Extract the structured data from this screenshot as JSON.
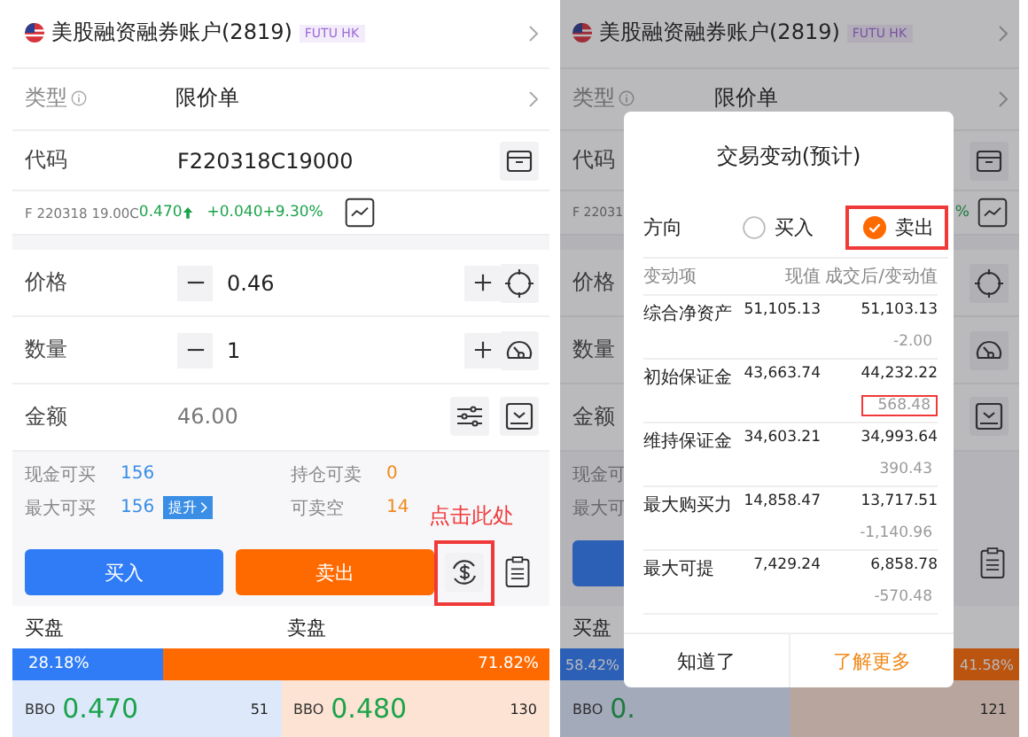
{
  "order_screen": {
    "account": {
      "name": "美股融资融券账户(2819)",
      "badge": "FUTU HK"
    },
    "order_type": {
      "label": "类型",
      "value": "限价单"
    },
    "code": {
      "label": "代码",
      "value": "F220318C19000"
    },
    "quote": {
      "name": "F 220318 19.00C",
      "price": "0.470",
      "change": "+0.040",
      "change_pct": "+9.30%"
    },
    "price": {
      "label": "价格",
      "value": "0.46"
    },
    "quantity": {
      "label": "数量",
      "value": "1"
    },
    "amount": {
      "label": "金额",
      "value": "46.00"
    },
    "power": [
      {
        "kind": "buy",
        "label": "现金可买",
        "value": "156"
      },
      {
        "kind": "sell",
        "label": "持仓可卖",
        "value": "0"
      },
      {
        "kind": "buy",
        "label": "最大可买",
        "value": "156",
        "action": "提升"
      },
      {
        "kind": "sell",
        "label": "可卖空",
        "value": "14"
      }
    ],
    "buy_button": "买入",
    "sell_button": "卖出",
    "annotation": "点击此处",
    "order_book": {
      "bid_label": "买盘",
      "ask_label": "卖盘",
      "bid_pct": "28.18%",
      "ask_pct": "71.82%",
      "level": 0.2818,
      "bid": {
        "tag": "BBO",
        "price": "0.470",
        "size": "51"
      },
      "ask": {
        "tag": "BBO",
        "price": "0.480",
        "size": "130"
      }
    }
  },
  "preview_screen": {
    "account": {
      "name": "美股融资融券账户(2819)",
      "badge": "FUTU HK"
    },
    "order_type": {
      "label": "类型",
      "value": "限价单"
    },
    "code": {
      "label": "代码"
    },
    "quote": {
      "name": "F 22031",
      "change_pct": "%"
    },
    "labels": [
      "价格",
      "数量",
      "金额"
    ],
    "power_labels": [
      "现金可",
      "最大可"
    ],
    "order_book": {
      "bid_label": "买盘",
      "bid_pct": "58.42%",
      "ask_pct": "41.58%",
      "level": 0.5842,
      "bid_tag": "BBO",
      "bid_price": "0.",
      "ask_size": "121"
    },
    "dialog": {
      "title": "交易变动(预计)",
      "direction_label": "方向",
      "options": [
        {
          "label": "买入",
          "selected": false,
          "highlighted": false
        },
        {
          "label": "卖出",
          "selected": true,
          "highlighted": true
        }
      ],
      "columns": [
        "变动项",
        "现值",
        "成交后/变动值"
      ],
      "rows": [
        {
          "item": "综合净资产",
          "current": "51,105.13",
          "after": "51,103.13",
          "delta": "-2.00",
          "highlighted": false
        },
        {
          "item": "初始保证金",
          "current": "43,663.74",
          "after": "44,232.22",
          "delta": "568.48",
          "highlighted": true
        },
        {
          "item": "维持保证金",
          "current": "34,603.21",
          "after": "34,993.64",
          "delta": "390.43",
          "highlighted": false
        },
        {
          "item": "最大购买力",
          "current": "14,858.47",
          "after": "13,717.51",
          "delta": "-1,140.96",
          "highlighted": false
        },
        {
          "item": "最大可提",
          "current": "7,429.24",
          "after": "6,858.78",
          "delta": "-570.48",
          "highlighted": false
        }
      ],
      "buttons": [
        {
          "kind": "dismiss",
          "label": "知道了"
        },
        {
          "kind": "link",
          "label": "了解更多"
        }
      ]
    }
  }
}
